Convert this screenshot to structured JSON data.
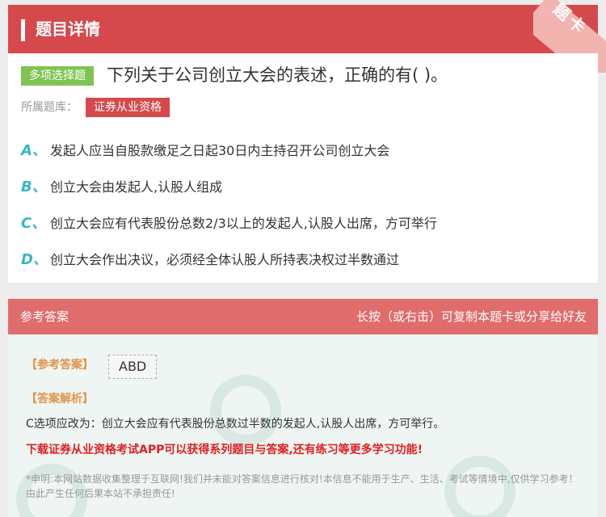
{
  "header": {
    "title": "题目详情",
    "corner_label": "题卡"
  },
  "question": {
    "type_badge": "多项选择题",
    "text": "下列关于公司创立大会的表述，正确的有( )。",
    "bank_label": "所属题库：",
    "bank_name": "证券从业资格",
    "options": [
      {
        "letter": "A、",
        "text": "发起人应当自股款缴足之日起30日内主持召开公司创立大会"
      },
      {
        "letter": "B、",
        "text": "创立大会由发起人,认股人组成"
      },
      {
        "letter": "C、",
        "text": "创立大会应有代表股份总数2/3以上的发起人,认股人出席，方可举行"
      },
      {
        "letter": "D、",
        "text": "创立大会作出决议，必须经全体认股人所持表决权过半数通过"
      }
    ]
  },
  "answer": {
    "title": "参考答案",
    "hint": "长按（或右击）可复制本题卡或分享给好友",
    "ref_label": "【参考答案】",
    "ref_value": "ABD",
    "analysis_label": "【答案解析】",
    "analysis_text": "C选项应改为：创立大会应有代表股份总数过半数的发起人,认股人出席，方可举行。",
    "promo": "下载证券从业资格考试APP可以获得系列题目与答案,还有练习等更多学习功能!",
    "disclaimer": "*申明:本网站数据收集整理于互联网!我们并未能对答案信息进行核对!本信息不能用于生产、生活、考试等情境中,仅供学习参考！由此产生任何后果本站不承担责任!"
  },
  "colors": {
    "brand_red": "#d5494d",
    "answer_red": "#e06c6c",
    "badge_green": "#7fc453",
    "option_teal": "#38b6c6",
    "label_orange": "#e0954a",
    "promo_red": "#e02020"
  }
}
